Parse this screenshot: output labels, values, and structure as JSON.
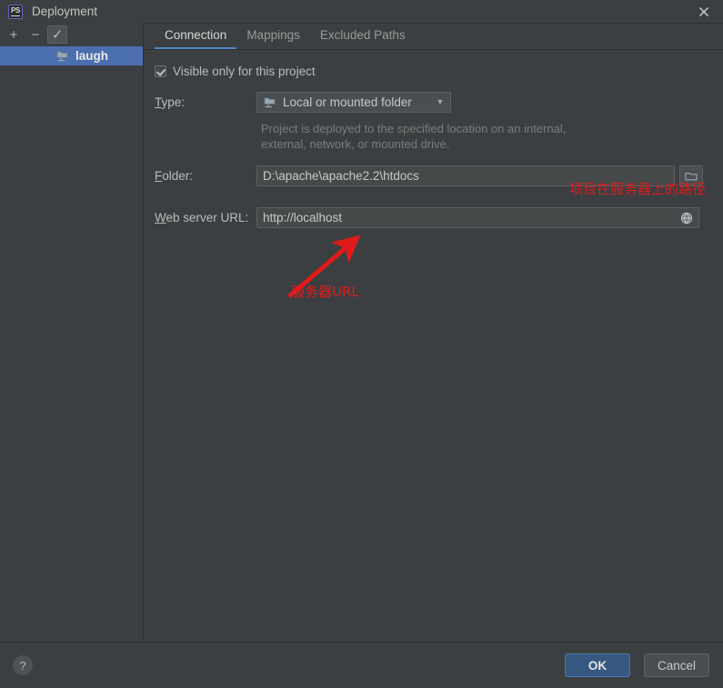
{
  "window": {
    "title": "Deployment",
    "app_icon": "phpstorm-icon",
    "app_icon_label": "PS",
    "close_icon": "close-icon"
  },
  "left_pane": {
    "toolbar": [
      {
        "name": "add-server-button",
        "glyph": "+"
      },
      {
        "name": "remove-server-button",
        "glyph": "−"
      },
      {
        "name": "use-as-default-button",
        "glyph": "✓"
      }
    ],
    "servers": [
      {
        "label": "laugh",
        "icon": "local-folder-server-icon",
        "selected": true
      }
    ]
  },
  "tabs": [
    {
      "label": "Connection",
      "active": true
    },
    {
      "label": "Mappings",
      "active": false
    },
    {
      "label": "Excluded Paths",
      "active": false
    }
  ],
  "connection": {
    "visible_only_checkbox": {
      "label": "Visible only for this project",
      "checked": true
    },
    "type": {
      "label_prefix": "T",
      "label_rest": "ype:",
      "value": "Local or mounted folder",
      "icon": "local-folder-icon",
      "arrow_icon": "chevron-down-icon"
    },
    "description": "Project is deployed to the specified location on an internal, external, network, or mounted drive.",
    "folder": {
      "label_prefix": "F",
      "label_rest": "older:",
      "value": "D:\\apache\\apache2.2\\htdocs",
      "browse_icon": "folder-browse-icon"
    },
    "web_server_url": {
      "label_prefix": "W",
      "label_rest": "eb server URL:",
      "value": "http://localhost",
      "globe_icon": "globe-icon"
    }
  },
  "annotations": {
    "path_note": "项目在服务器上的路径",
    "url_note": "服务器URL",
    "arrow_color": "#e01b1b"
  },
  "footer": {
    "help_glyph": "?",
    "ok_label": "OK",
    "cancel_label": "Cancel"
  },
  "colors": {
    "window_bg": "#3c3f41",
    "selection_blue": "#4b6eaf",
    "tab_underline": "#4a88c7",
    "ok_button": "#365880",
    "annotation_red": "#e01b1b"
  }
}
